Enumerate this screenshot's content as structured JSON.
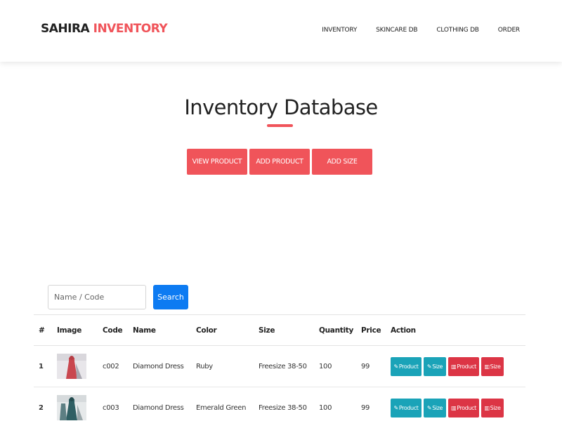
{
  "brand": {
    "part1": "SAHIRA",
    "part2": "INVENTORY",
    "accent_color": "#f0545a"
  },
  "nav": {
    "items": [
      {
        "label": "INVENTORY"
      },
      {
        "label": "SKINCARE DB"
      },
      {
        "label": "CLOTHING DB"
      },
      {
        "label": "ORDER"
      }
    ]
  },
  "hero": {
    "title": "Inventory Database",
    "buttons": {
      "view": "VIEW PRODUCT",
      "add_product": "ADD PRODUCT",
      "add_size": "ADD SIZE"
    },
    "button_color": "#f0545a"
  },
  "search": {
    "placeholder": "Name / Code",
    "value": "",
    "button": "Search",
    "button_color": "#0d7bf2"
  },
  "table": {
    "headers": {
      "idx": "#",
      "image": "Image",
      "code": "Code",
      "name": "Name",
      "color": "Color",
      "size": "Size",
      "quantity": "Quantity",
      "price": "Price",
      "action": "Action"
    },
    "rows": [
      {
        "idx": "1",
        "code": "c002",
        "name": "Diamond Dress",
        "color": "Ruby",
        "size": "Freesize 38-50",
        "quantity": "100",
        "price": "99",
        "image_icon": "dress-photo-icon"
      },
      {
        "idx": "2",
        "code": "c003",
        "name": "Diamond Dress",
        "color": "Emerald Green",
        "size": "Freesize 38-50",
        "quantity": "100",
        "price": "99",
        "image_icon": "dress-photo-icon"
      }
    ],
    "actions": {
      "edit_product": "Product",
      "edit_size": "Size",
      "delete_product": "Product",
      "delete_size": "Size"
    },
    "action_colors": {
      "edit": "#1aa3b8",
      "delete": "#dc3545"
    }
  }
}
